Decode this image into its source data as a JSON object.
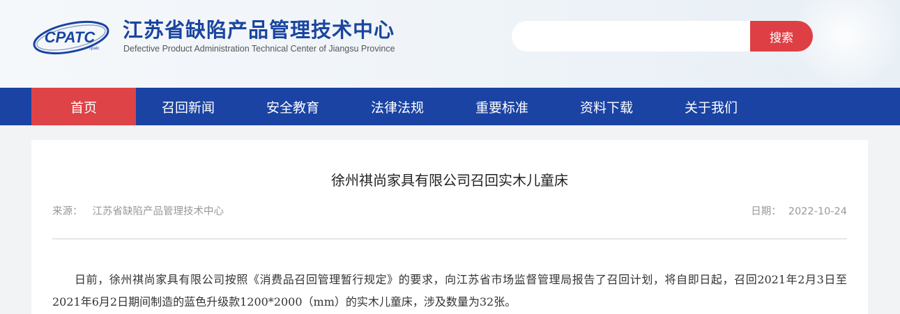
{
  "header": {
    "logo_text": "CPATC",
    "logo_small_text": "cpatc",
    "title": "江苏省缺陷产品管理技术中心",
    "subtitle": "Defective Product Administration Technical Center of Jiangsu Province"
  },
  "search": {
    "placeholder": "",
    "value": "",
    "button_label": "搜索"
  },
  "nav": {
    "items": [
      {
        "label": "首页",
        "active": true
      },
      {
        "label": "召回新闻"
      },
      {
        "label": "安全教育"
      },
      {
        "label": "法律法规"
      },
      {
        "label": "重要标准"
      },
      {
        "label": "资料下载"
      },
      {
        "label": "关于我们"
      }
    ]
  },
  "article": {
    "title": "徐州祺尚家具有限公司召回实木儿童床",
    "source_label": "来源：",
    "source_value": "江苏省缺陷产品管理技术中心",
    "date_label": "日期：",
    "date_value": "2022-10-24",
    "paragraph": "日前，徐州祺尚家具有限公司按照《消费品召回管理暂行规定》的要求，向江苏省市场监督管理局报告了召回计划，将自即日起，召回2021年2月3日至2021年6月2日期间制造的蓝色升级款1200*2000（mm）的实木儿童床，涉及数量为32张。"
  },
  "colors": {
    "nav_bg": "#1a43a3",
    "nav_active": "#de4347",
    "title_blue": "#1a45a0",
    "search_button": "#de3f45"
  }
}
